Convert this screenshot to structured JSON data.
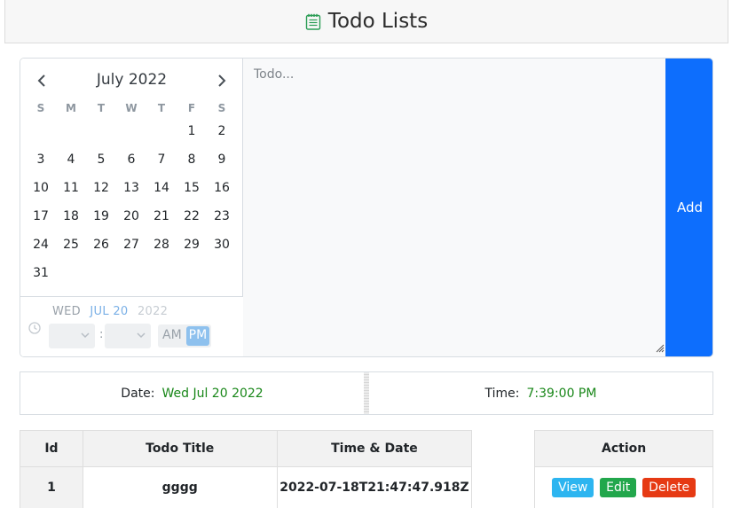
{
  "header": {
    "title": "Todo Lists",
    "icon": "notepad-icon"
  },
  "calendar": {
    "month_label": "July 2022",
    "weekdays": [
      "S",
      "M",
      "T",
      "W",
      "T",
      "F",
      "S"
    ],
    "weeks": [
      [
        "",
        "",
        "",
        "",
        "",
        "1",
        "2"
      ],
      [
        "3",
        "4",
        "5",
        "6",
        "7",
        "8",
        "9"
      ],
      [
        "10",
        "11",
        "12",
        "13",
        "14",
        "15",
        "16"
      ],
      [
        "17",
        "18",
        "19",
        "20",
        "21",
        "22",
        "23"
      ],
      [
        "24",
        "25",
        "26",
        "27",
        "28",
        "29",
        "30"
      ],
      [
        "31",
        "",
        "",
        "",
        "",
        "",
        ""
      ]
    ],
    "footer": {
      "weekday": "WED",
      "month_day": "JUL 20",
      "year": "2022",
      "am": "AM",
      "pm": "PM",
      "selected_period": "PM",
      "separator": ":"
    }
  },
  "todo": {
    "placeholder": "Todo...",
    "value": ""
  },
  "add_button": {
    "label": "Add"
  },
  "info": {
    "date_label": "Date:",
    "date_value": "Wed Jul 20 2022",
    "time_label": "Time:",
    "time_value": "7:39:00 PM"
  },
  "table": {
    "headers": {
      "id": "Id",
      "title": "Todo Title",
      "time_date": "Time & Date",
      "blank": "",
      "action": "Action"
    },
    "rows": [
      {
        "id": "1",
        "title": "gggg",
        "time_date": "2022-07-18T21:47:47.918Z",
        "view": "View",
        "edit": "Edit",
        "delete": "Delete"
      }
    ]
  },
  "colors": {
    "accent": "#0d6efd",
    "success_text": "#198719",
    "view": "#2db5f0",
    "edit": "#22a74c",
    "delete": "#e63a14",
    "selected_period": "#8ec1ee"
  }
}
